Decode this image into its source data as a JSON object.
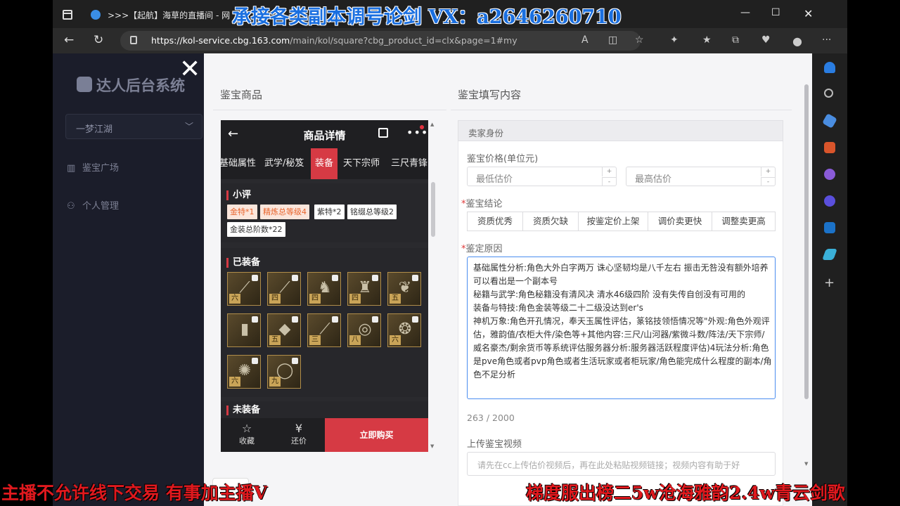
{
  "browser": {
    "tab_title": ">>>【起航】海草的直播间 - 网",
    "url_host": "https://kol-service.cbg.163.com",
    "url_path": "/main/kol/square?cbg_product_id=clx&page=1#my"
  },
  "overlay": {
    "top_banner": "承接各类副本调号论剑 VX：a2646260710",
    "bottom_left": "主播不允许线下交易 有事加主播V",
    "bottom_right": "梯度服出榜二5w沧海雅韵2.4w青云剑歌"
  },
  "sidebar": {
    "logo": "达人后台系统",
    "server": "一梦江湖",
    "items": [
      {
        "label": "鉴宝广场"
      },
      {
        "label": "个人管理"
      }
    ]
  },
  "modal": {
    "left_title": "鉴宝商品",
    "right_title": "鉴宝填写内容"
  },
  "phone": {
    "title": "商品详情",
    "tabs": [
      "基础属性",
      "武学/秘笈",
      "装备",
      "天下宗师",
      "三尺青锋"
    ],
    "active_tab": "装备",
    "review_title": "小评",
    "tags": [
      "金特*1",
      "精炼总等级4",
      "紫特*2",
      "铭缀总等级2",
      "金装总阶数*22"
    ],
    "equipped_title": "已装备",
    "grades": [
      "六",
      "四",
      "四",
      "四",
      "五",
      "",
      "五",
      "三",
      "八",
      "六",
      "六",
      "九"
    ],
    "unequipped_title": "未装备",
    "bottom": {
      "favorite": "收藏",
      "counter_offer": "还价",
      "buy": "立即购买"
    }
  },
  "form": {
    "seller_label": "卖家身份",
    "price_label": "鉴宝价格(单位元)",
    "min_placeholder": "最低估价",
    "max_placeholder": "最高估价",
    "conclusion_label": "鉴宝结论",
    "conclusions": [
      "资质优秀",
      "资质欠缺",
      "按鉴定价上架",
      "调价卖更快",
      "调整卖更高"
    ],
    "reason_label": "鉴定原因",
    "reason_text": "基础属性分析:角色大外白字两万 诛心坚韧均是八千左右 振击无咎没有额外培养 可以看出是一个副本号\n秘籍与武学:角色秘籍没有清风决 清水46级四阶 没有失传自创没有可用的\n装备与特技:角色金装等级二十二级没达到er's\n神机万象:角色开孔情况，奉天玉属性评估，篆铭技领悟情况等\"外观:角色外观评估，雅韵值/衣柜大件/染色等+其他内容:三尺/山河器/紫微斗数/阵法/天下宗师/威名豪杰/剩余货币等系统评估服务器分析:服务器活跃程度评估)4玩法分析:角色是pve角色或者pvp角色或者生活玩家或者柜玩家/角色能完成什么程度的副本/角色不足分析",
    "counter": "263 / 2000",
    "video_label": "上传鉴宝视频",
    "video_placeholder": "请先在cc上传估价视频后，再在此处粘贴视频链接；视频内容有助于好"
  }
}
